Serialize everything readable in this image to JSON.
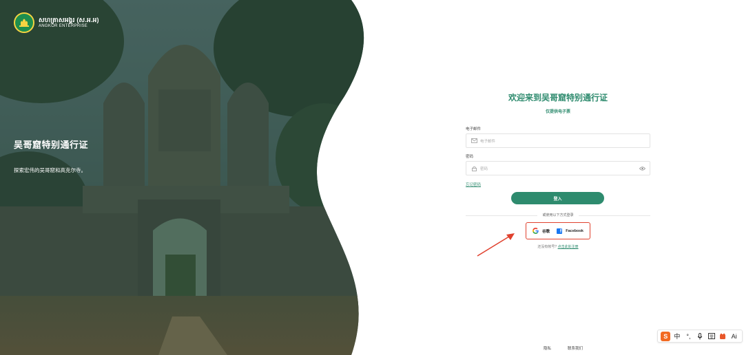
{
  "brand": {
    "khmer_name": "សហគ្រាសអង្គរ (ស.អ.អ)",
    "english_name": "ANGKOR ENTERPRISE"
  },
  "hero": {
    "title": "吴哥窟特别通行证",
    "subtitle": "探索宏伟的吴哥窟和高克尔寺。"
  },
  "form": {
    "welcome": "欢迎来到吴哥窟特别通行证",
    "subtitle": "仅提供电子票",
    "email_label": "电子邮件",
    "email_placeholder": "电子邮件",
    "password_label": "密码",
    "password_placeholder": "密码",
    "forgot_password": "忘记密码",
    "login_button": "登入",
    "divider_text": "或使用以下方式登录",
    "google_label": "谷歌",
    "facebook_label": "Facebook",
    "no_account_text": "还没有帐号?",
    "signup_link": "点击此处注册"
  },
  "footer": {
    "privacy": "隐私",
    "contact": "联系我们"
  },
  "ime_toolbar": {
    "logo": "S",
    "mode": "中",
    "punct": "°,",
    "ai": "Ai"
  },
  "colors": {
    "accent": "#2e8b6e",
    "highlight_box": "#e0412e",
    "hero_overlay": "#2f4f3f"
  },
  "icons": [
    "mail-icon",
    "lock-icon",
    "eye-icon",
    "google-icon",
    "facebook-icon",
    "arrow-annotation"
  ]
}
